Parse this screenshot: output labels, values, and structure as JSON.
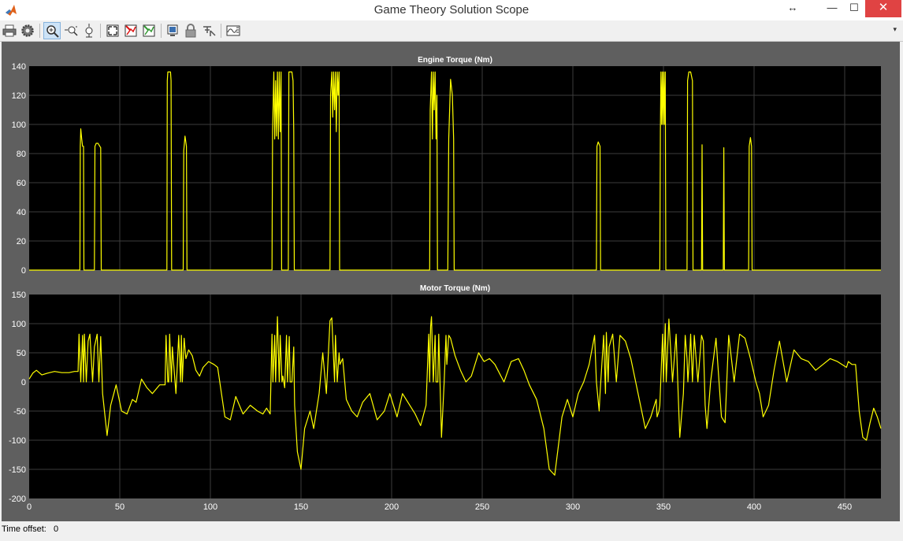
{
  "window": {
    "title": "Game Theory Solution Scope",
    "controls": {
      "resize": "↔",
      "minimize": "—",
      "maximize": "☐",
      "close": "✕"
    }
  },
  "toolbar": {
    "buttons": [
      {
        "name": "print-icon",
        "active": false
      },
      {
        "name": "gear-icon",
        "active": false
      },
      {
        "name": "zoom-in-icon",
        "active": true
      },
      {
        "name": "zoom-x-icon",
        "active": false
      },
      {
        "name": "zoom-y-icon",
        "active": false
      },
      {
        "name": "autoscale-icon",
        "active": false
      },
      {
        "name": "save-axes-icon",
        "active": false
      },
      {
        "name": "restore-axes-icon",
        "active": false
      },
      {
        "name": "floating-scope-icon",
        "active": false
      },
      {
        "name": "lock-icon",
        "active": false
      },
      {
        "name": "signal-selection-icon",
        "active": false
      },
      {
        "name": "legend-icon",
        "active": false
      }
    ],
    "overflow": "▾"
  },
  "status": {
    "label": "Time offset:",
    "value": "0"
  },
  "colors": {
    "figure_bg": "#5f5f5f",
    "axes_bg": "#000000",
    "line": "#ffff00",
    "grid": "#3c3c3c",
    "tick_text": "#ffffff"
  },
  "chart_data": [
    {
      "type": "line",
      "title": "Engine Torque (Nm)",
      "xlabel": "",
      "ylabel": "",
      "xlim": [
        0,
        470
      ],
      "ylim": [
        0,
        140
      ],
      "xticks": [
        0,
        50,
        100,
        150,
        200,
        250,
        300,
        350,
        400,
        450
      ],
      "yticks": [
        0,
        20,
        40,
        60,
        80,
        100,
        120,
        140
      ],
      "grid": true,
      "x": [
        0,
        28,
        28.2,
        28.5,
        29,
        29.5,
        30,
        30.2,
        36,
        36.3,
        37,
        38,
        39,
        39.5,
        39.8,
        76,
        76.2,
        76.5,
        78,
        78.3,
        78.6,
        85,
        85.3,
        86,
        86.8,
        87.1,
        134,
        134.3,
        135,
        135.5,
        136,
        136.5,
        137,
        137.5,
        138,
        138.5,
        139,
        139.3,
        143,
        143.3,
        144,
        145,
        145.6,
        146,
        146.3,
        166,
        166.3,
        167,
        167.5,
        168,
        168.5,
        169,
        169.5,
        170,
        170.5,
        171,
        171.3,
        221,
        221.3,
        222,
        222.5,
        223,
        223.5,
        224,
        224.5,
        225,
        225.3,
        231,
        231.5,
        232.5,
        233.5,
        234.2,
        234.5,
        313,
        313.3,
        314,
        315,
        315.3,
        348,
        348.3,
        348.6,
        349,
        349.4,
        349.8,
        350.2,
        350.6,
        351,
        351.3,
        363,
        363.3,
        364,
        365,
        366,
        366.3,
        371,
        371.3,
        371.6,
        383,
        383.3,
        383.6,
        397,
        397.3,
        398,
        398.6,
        398.9,
        470
      ],
      "y": [
        0,
        0,
        85,
        97,
        90,
        85,
        85,
        0,
        0,
        85,
        87,
        87,
        85,
        84,
        0,
        0,
        130,
        136,
        136,
        130,
        0,
        0,
        82,
        92,
        85,
        0,
        0,
        95,
        136,
        90,
        130,
        92,
        136,
        90,
        136,
        95,
        136,
        0,
        0,
        136,
        136,
        136,
        130,
        95,
        0,
        0,
        120,
        136,
        105,
        136,
        110,
        136,
        95,
        136,
        120,
        136,
        0,
        0,
        110,
        136,
        90,
        136,
        110,
        136,
        90,
        120,
        0,
        0,
        90,
        131,
        120,
        90,
        0,
        0,
        85,
        88,
        85,
        0,
        0,
        95,
        136,
        100,
        136,
        100,
        136,
        100,
        136,
        0,
        0,
        130,
        136,
        136,
        130,
        0,
        0,
        86,
        0,
        0,
        84,
        0,
        0,
        85,
        91,
        85,
        0,
        0
      ]
    },
    {
      "type": "line",
      "title": "Motor Torque (Nm)",
      "xlabel": "",
      "ylabel": "",
      "xlim": [
        0,
        470
      ],
      "ylim": [
        -200,
        150
      ],
      "xticks": [
        0,
        50,
        100,
        150,
        200,
        250,
        300,
        350,
        400,
        450
      ],
      "yticks": [
        -200,
        -150,
        -100,
        -50,
        0,
        50,
        100,
        150
      ],
      "grid": true,
      "x": [
        0,
        2,
        4,
        7,
        10,
        14,
        18,
        22,
        25,
        27,
        27.5,
        28.5,
        29.5,
        30,
        30.5,
        31.5,
        32.5,
        33.5,
        35,
        36,
        37.5,
        38.5,
        39.5,
        40.5,
        43,
        45,
        48,
        51,
        54,
        57,
        59,
        62,
        65,
        68,
        72,
        75,
        75.5,
        76.5,
        77,
        77.5,
        78.5,
        79,
        81,
        82.5,
        83.5,
        84,
        84.5,
        85.5,
        86.5,
        88,
        90,
        92,
        94,
        96,
        99,
        102,
        104,
        108,
        111,
        114,
        118,
        122,
        126,
        129,
        131,
        133,
        134,
        134.5,
        135.5,
        136,
        137,
        138,
        138.5,
        139.5,
        140,
        141,
        142,
        142.5,
        143.5,
        144,
        145,
        146,
        146.5,
        148,
        150,
        152,
        155,
        157,
        160,
        162,
        164,
        166,
        167,
        168.5,
        169,
        170,
        171,
        171.5,
        173,
        175,
        178,
        181,
        184,
        188,
        192,
        196,
        199,
        203,
        206,
        210,
        213,
        216,
        219,
        220.5,
        221,
        221.5,
        222,
        223,
        224,
        224.5,
        225.5,
        226,
        227.5,
        229,
        230,
        230.5,
        231.5,
        232.5,
        235,
        238,
        241,
        244,
        248,
        251,
        254,
        257,
        262,
        266,
        270,
        273,
        276,
        280,
        284,
        287,
        290,
        294,
        297,
        300,
        303,
        306,
        309,
        312,
        313,
        314.5,
        315,
        317,
        318,
        318.5,
        319.5,
        320,
        322,
        324,
        326,
        329,
        332,
        336,
        340,
        343,
        345,
        346,
        346.5,
        347.5,
        348,
        349.5,
        350,
        351,
        351.5,
        353,
        355,
        357,
        358,
        359,
        361,
        362,
        363,
        363.5,
        364.5,
        365,
        366,
        367,
        369,
        371,
        372,
        373,
        374,
        376,
        379,
        382,
        384,
        386,
        389,
        392,
        395,
        398,
        401,
        403,
        405,
        408,
        411,
        414,
        418,
        422,
        426,
        430,
        434,
        438,
        442,
        446,
        451,
        452,
        454,
        456,
        458,
        460,
        462,
        464,
        466,
        468,
        470
      ],
      "y": [
        5,
        15,
        20,
        12,
        15,
        18,
        16,
        16,
        18,
        18,
        82,
        0,
        80,
        0,
        82,
        0,
        70,
        82,
        0,
        60,
        82,
        0,
        78,
        -20,
        -92,
        -40,
        -5,
        -50,
        -55,
        -30,
        -35,
        5,
        -10,
        -20,
        -5,
        -5,
        80,
        0,
        0,
        82,
        0,
        60,
        -20,
        80,
        0,
        80,
        0,
        75,
        40,
        55,
        45,
        20,
        10,
        25,
        35,
        30,
        25,
        -60,
        -65,
        -25,
        -55,
        -40,
        -50,
        -55,
        -45,
        -55,
        82,
        0,
        80,
        0,
        112,
        0,
        80,
        0,
        10,
        -10,
        80,
        0,
        78,
        0,
        0,
        60,
        -40,
        -120,
        -150,
        -80,
        -50,
        -80,
        -20,
        50,
        -20,
        105,
        110,
        0,
        80,
        0,
        50,
        30,
        40,
        -30,
        -50,
        -60,
        -35,
        -20,
        -65,
        -50,
        -20,
        -60,
        -20,
        -40,
        -55,
        -75,
        -40,
        82,
        0,
        95,
        112,
        0,
        80,
        0,
        0,
        82,
        -95,
        0,
        80,
        30,
        80,
        75,
        45,
        20,
        0,
        10,
        50,
        35,
        40,
        30,
        0,
        35,
        40,
        20,
        -5,
        -30,
        -80,
        -150,
        -160,
        -60,
        -30,
        -60,
        -20,
        0,
        30,
        80,
        0,
        -50,
        -20,
        80,
        -20,
        85,
        0,
        60,
        82,
        0,
        80,
        70,
        40,
        -20,
        -80,
        -60,
        -40,
        -30,
        -60,
        -50,
        -40,
        82,
        0,
        100,
        0,
        108,
        0,
        82,
        -10,
        -95,
        -20,
        80,
        40,
        0,
        50,
        82,
        0,
        80,
        0,
        80,
        70,
        -40,
        -80,
        0,
        75,
        -60,
        -70,
        80,
        0,
        82,
        75,
        40,
        0,
        -20,
        -60,
        -40,
        20,
        70,
        0,
        55,
        40,
        35,
        20,
        30,
        40,
        35,
        25,
        35,
        30,
        30,
        -50,
        -95,
        -100,
        -70,
        -45,
        -60,
        -80,
        -65,
        -75,
        -70
      ]
    }
  ]
}
